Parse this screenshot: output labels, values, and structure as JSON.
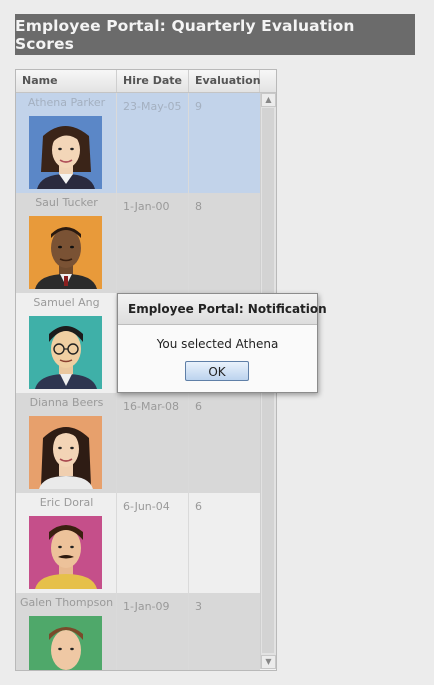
{
  "header": {
    "title": "Employee Portal: Quarterly Evaluation Scores"
  },
  "grid": {
    "columns": [
      "Name",
      "Hire Date",
      "Evaluation"
    ],
    "rows": [
      {
        "name": "Athena Parker",
        "hire_date": "23-May-05",
        "evaluation": "9"
      },
      {
        "name": "Saul Tucker",
        "hire_date": "1-Jan-00",
        "evaluation": "8"
      },
      {
        "name": "Samuel Ang",
        "hire_date": "",
        "evaluation": ""
      },
      {
        "name": "Dianna Beers",
        "hire_date": "16-Mar-08",
        "evaluation": "6"
      },
      {
        "name": "Eric Doral",
        "hire_date": "6-Jun-04",
        "evaluation": "6"
      },
      {
        "name": "Galen Thompson",
        "hire_date": "1-Jan-09",
        "evaluation": "3"
      }
    ]
  },
  "dialog": {
    "title": "Employee Portal: Notification",
    "message": "You selected Athena",
    "ok_label": "OK"
  },
  "icons": {
    "scroll_up": "arrow-up-icon",
    "scroll_down": "arrow-down-icon"
  },
  "colors": {
    "title_bar": "#6b6b6b",
    "selected_row": "#c2d3ea",
    "alt_row": "#d8d8d8"
  }
}
